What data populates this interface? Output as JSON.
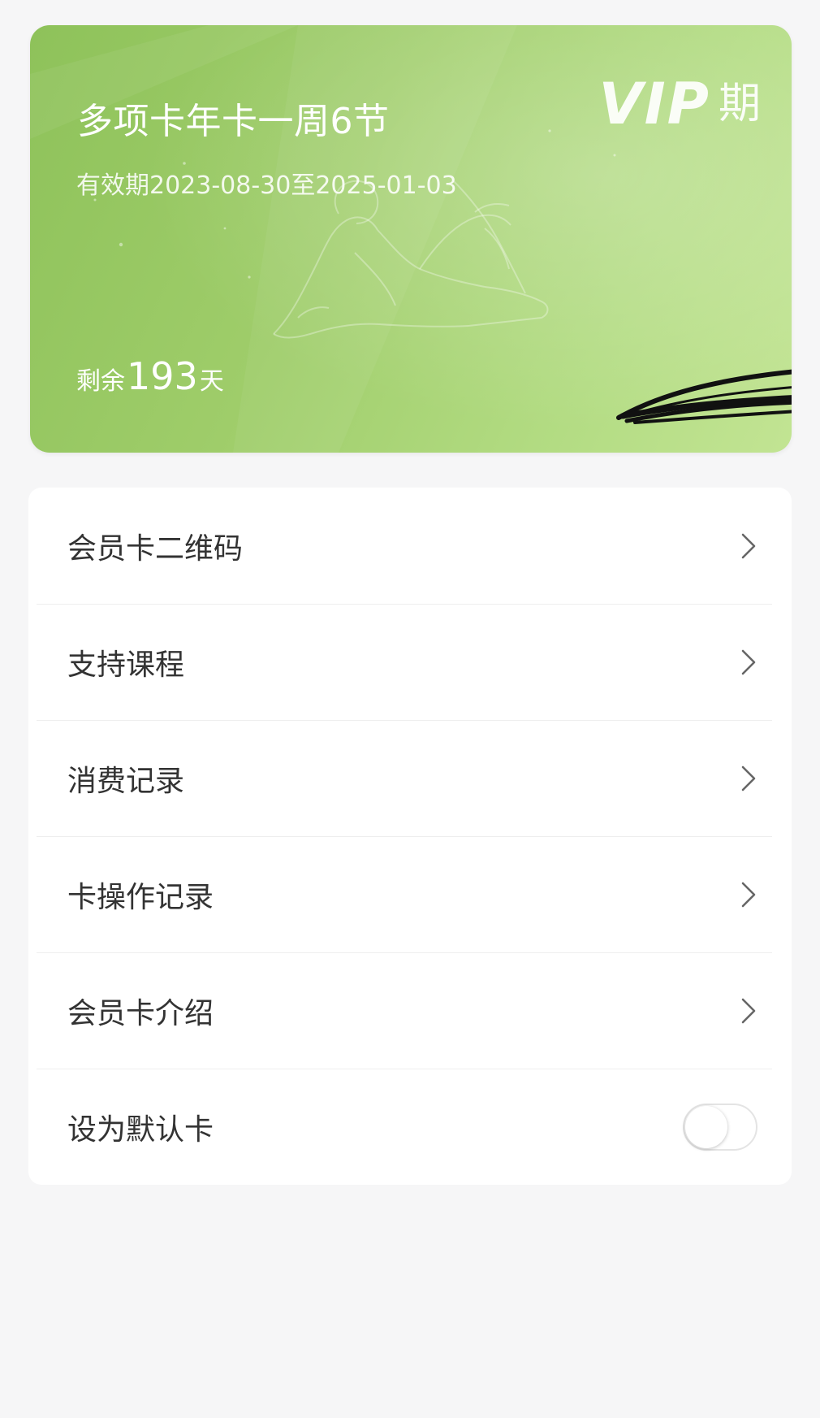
{
  "card": {
    "title": "多项卡年卡一周6节",
    "validity": "有效期2023-08-30至2025-01-03",
    "vip_logo": "VIP",
    "vip_suffix": "期",
    "remaining_label": "剩余",
    "remaining_days": "193",
    "remaining_unit": "天",
    "colors": {
      "gradient_start": "#8ec25a",
      "gradient_end": "#c2e493"
    }
  },
  "menu": {
    "items": [
      {
        "label": "会员卡二维码",
        "icon": "chevron-right-icon"
      },
      {
        "label": "支持课程",
        "icon": "chevron-right-icon"
      },
      {
        "label": "消费记录",
        "icon": "chevron-right-icon"
      },
      {
        "label": "卡操作记录",
        "icon": "chevron-right-icon"
      },
      {
        "label": "会员卡介绍",
        "icon": "chevron-right-icon"
      }
    ],
    "default_card": {
      "label": "设为默认卡",
      "enabled": false
    }
  }
}
